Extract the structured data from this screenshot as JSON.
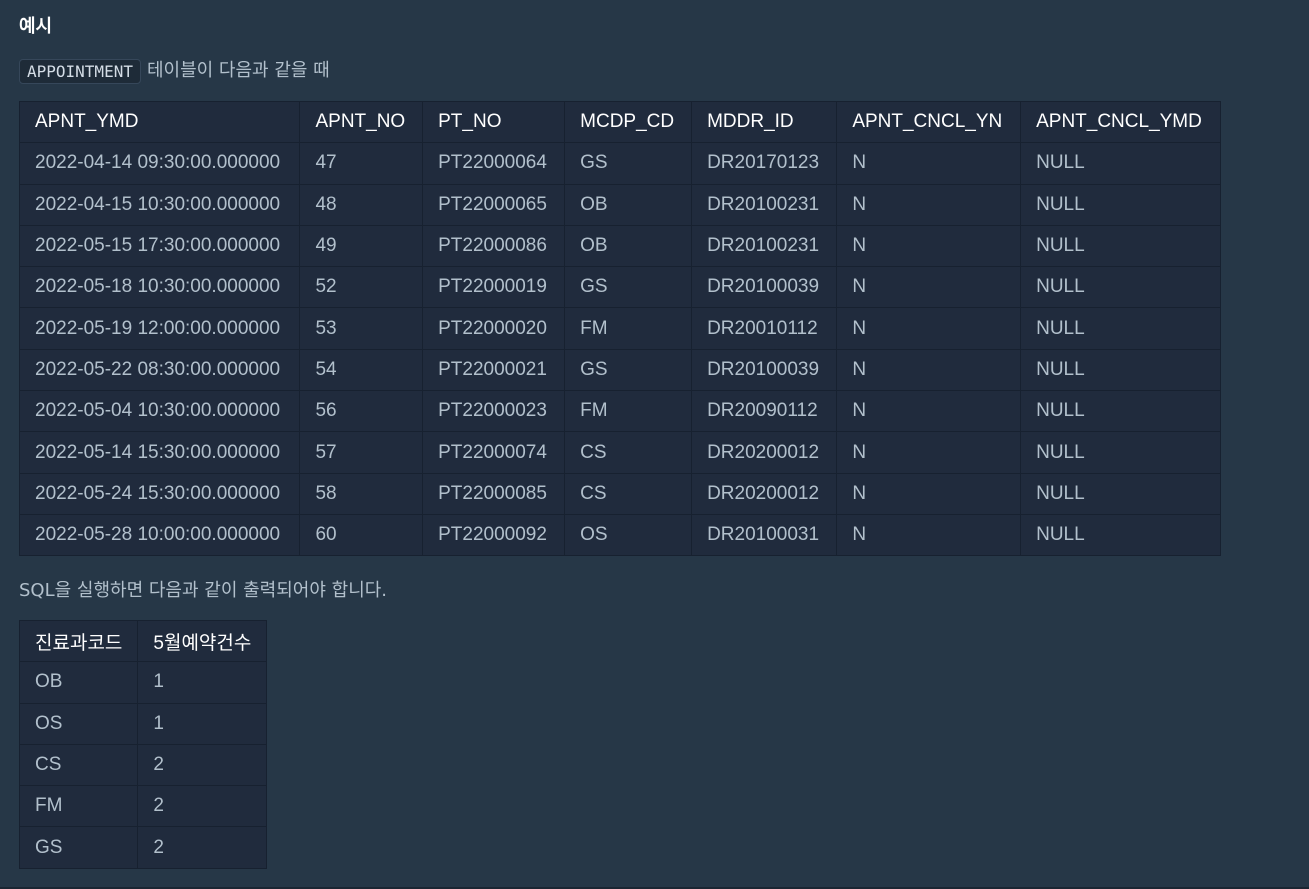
{
  "heading": "예시",
  "intro": {
    "code": "APPOINTMENT",
    "text": "테이블이 다음과 같을 때"
  },
  "appointment_table": {
    "columns": [
      "APNT_YMD",
      "APNT_NO",
      "PT_NO",
      "MCDP_CD",
      "MDDR_ID",
      "APNT_CNCL_YN",
      "APNT_CNCL_YMD"
    ],
    "rows": [
      [
        "2022-04-14 09:30:00.000000",
        "47",
        "PT22000064",
        "GS",
        "DR20170123",
        "N",
        "NULL"
      ],
      [
        "2022-04-15 10:30:00.000000",
        "48",
        "PT22000065",
        "OB",
        "DR20100231",
        "N",
        "NULL"
      ],
      [
        "2022-05-15 17:30:00.000000",
        "49",
        "PT22000086",
        "OB",
        "DR20100231",
        "N",
        "NULL"
      ],
      [
        "2022-05-18 10:30:00.000000",
        "52",
        "PT22000019",
        "GS",
        "DR20100039",
        "N",
        "NULL"
      ],
      [
        "2022-05-19 12:00:00.000000",
        "53",
        "PT22000020",
        "FM",
        "DR20010112",
        "N",
        "NULL"
      ],
      [
        "2022-05-22 08:30:00.000000",
        "54",
        "PT22000021",
        "GS",
        "DR20100039",
        "N",
        "NULL"
      ],
      [
        "2022-05-04 10:30:00.000000",
        "56",
        "PT22000023",
        "FM",
        "DR20090112",
        "N",
        "NULL"
      ],
      [
        "2022-05-14 15:30:00.000000",
        "57",
        "PT22000074",
        "CS",
        "DR20200012",
        "N",
        "NULL"
      ],
      [
        "2022-05-24 15:30:00.000000",
        "58",
        "PT22000085",
        "CS",
        "DR20200012",
        "N",
        "NULL"
      ],
      [
        "2022-05-28 10:00:00.000000",
        "60",
        "PT22000092",
        "OS",
        "DR20100031",
        "N",
        "NULL"
      ]
    ]
  },
  "result_text": "SQL을 실행하면 다음과 같이 출력되어야 합니다.",
  "result_table": {
    "columns": [
      "진료과코드",
      "5월예약건수"
    ],
    "rows": [
      [
        "OB",
        "1"
      ],
      [
        "OS",
        "1"
      ],
      [
        "CS",
        "2"
      ],
      [
        "FM",
        "2"
      ],
      [
        "GS",
        "2"
      ]
    ]
  }
}
